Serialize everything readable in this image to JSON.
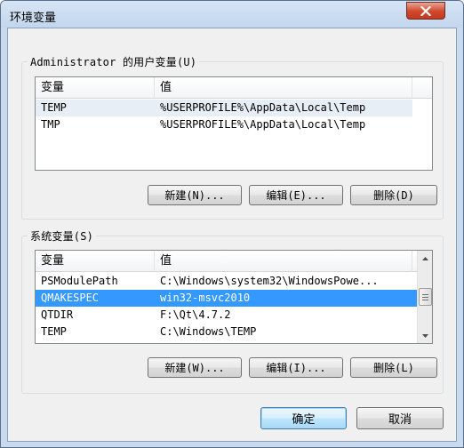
{
  "window": {
    "title": "环境变量"
  },
  "user_group": {
    "legend": "Administrator 的用户变量(U)",
    "columns": [
      "变量",
      "值"
    ],
    "rows": [
      {
        "name": "TEMP",
        "value": "%USERPROFILE%\\AppData\\Local\\Temp"
      },
      {
        "name": "TMP",
        "value": "%USERPROFILE%\\AppData\\Local\\Temp"
      }
    ],
    "buttons": {
      "new": "新建(N)...",
      "edit": "编辑(E)...",
      "delete": "删除(D)"
    }
  },
  "system_group": {
    "legend": "系统变量(S)",
    "columns": [
      "变量",
      "值"
    ],
    "rows": [
      {
        "name": "PSModulePath",
        "value": "C:\\Windows\\system32\\WindowsPowe..."
      },
      {
        "name": "QMAKESPEC",
        "value": "win32-msvc2010"
      },
      {
        "name": "QTDIR",
        "value": "F:\\Qt\\4.7.2"
      },
      {
        "name": "TEMP",
        "value": "C:\\Windows\\TEMP"
      }
    ],
    "buttons": {
      "new": "新建(W)...",
      "edit": "编辑(I)...",
      "delete": "删除(L)"
    }
  },
  "footer": {
    "ok": "确定",
    "cancel": "取消"
  },
  "icons": {
    "close": "close-icon",
    "scroll_up": "arrow-up-icon",
    "scroll_down": "arrow-down-icon",
    "grip": "grip-icon"
  },
  "colors": {
    "selection": "#3399ff",
    "close_button": "#c94125",
    "title_bar": "#c9daee"
  }
}
